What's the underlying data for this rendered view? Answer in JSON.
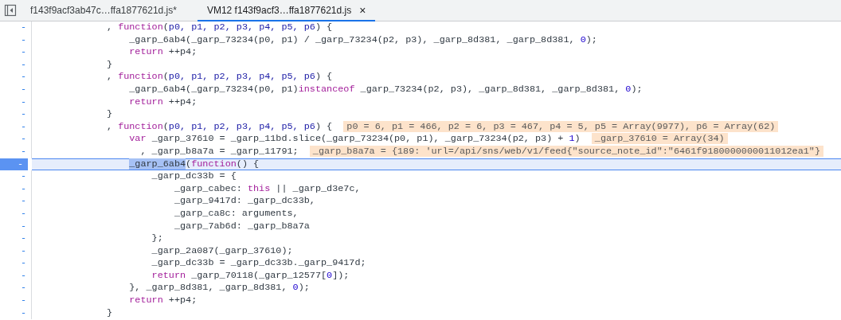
{
  "tabs": [
    {
      "label": "f143f9acf3ab47c…ffa1877621d.js*",
      "selected": false
    },
    {
      "label": "VM12 f143f9acf3…ffa1877621d.js",
      "selected": true,
      "close": "×"
    }
  ],
  "editor": {
    "lines": [
      {
        "gutter": "-",
        "current": false,
        "segments": [
          {
            "kind": "plain",
            "text": "            , "
          },
          {
            "kind": "keyword",
            "text": "function"
          },
          {
            "kind": "plain",
            "text": "("
          },
          {
            "kind": "param",
            "text": "p0, p1, p2, p3, p4, p5, p6"
          },
          {
            "kind": "plain",
            "text": ") {"
          }
        ]
      },
      {
        "gutter": "-",
        "current": false,
        "segments": [
          {
            "kind": "plain",
            "text": "                _garp_6ab4(_garp_73234(p0, p1) / _garp_73234(p2, p3), _garp_8d381, _garp_8d381, "
          },
          {
            "kind": "number",
            "text": "0"
          },
          {
            "kind": "plain",
            "text": ");"
          }
        ]
      },
      {
        "gutter": "-",
        "current": false,
        "segments": [
          {
            "kind": "keyword",
            "text": "                return"
          },
          {
            "kind": "plain",
            "text": " ++p4;"
          }
        ]
      },
      {
        "gutter": "-",
        "current": false,
        "segments": [
          {
            "kind": "plain",
            "text": "            }"
          }
        ]
      },
      {
        "gutter": "-",
        "current": false,
        "segments": [
          {
            "kind": "plain",
            "text": "            , "
          },
          {
            "kind": "keyword",
            "text": "function"
          },
          {
            "kind": "plain",
            "text": "("
          },
          {
            "kind": "param",
            "text": "p0, p1, p2, p3, p4, p5, p6"
          },
          {
            "kind": "plain",
            "text": ") {"
          }
        ]
      },
      {
        "gutter": "-",
        "current": false,
        "segments": [
          {
            "kind": "plain",
            "text": "                _garp_6ab4(_garp_73234(p0, p1)"
          },
          {
            "kind": "keyword",
            "text": "instanceof"
          },
          {
            "kind": "plain",
            "text": " _garp_73234(p2, p3), _garp_8d381, _garp_8d381, "
          },
          {
            "kind": "number",
            "text": "0"
          },
          {
            "kind": "plain",
            "text": ");"
          }
        ]
      },
      {
        "gutter": "-",
        "current": false,
        "segments": [
          {
            "kind": "keyword",
            "text": "                return"
          },
          {
            "kind": "plain",
            "text": " ++p4;"
          }
        ]
      },
      {
        "gutter": "-",
        "current": false,
        "segments": [
          {
            "kind": "plain",
            "text": "            }"
          }
        ]
      },
      {
        "gutter": "-",
        "current": false,
        "segments": [
          {
            "kind": "plain",
            "text": "            , "
          },
          {
            "kind": "keyword",
            "text": "function"
          },
          {
            "kind": "plain",
            "text": "("
          },
          {
            "kind": "param",
            "text": "p0, p1, p2, p3, p4, p5, p6"
          },
          {
            "kind": "plain",
            "text": ") {  "
          },
          {
            "kind": "inline_value",
            "text": "p0 = 6, p1 = 466, p2 = 6, p3 = 467, p4 = 5, p5 = Array(9977), p6 = Array(62)"
          }
        ]
      },
      {
        "gutter": "-",
        "current": false,
        "segments": [
          {
            "kind": "keyword",
            "text": "                var"
          },
          {
            "kind": "plain",
            "text": " _garp_37610 = _garp_11bd.slice(_garp_73234(p0, p1), _garp_73234(p2, p3) + "
          },
          {
            "kind": "number",
            "text": "1"
          },
          {
            "kind": "plain",
            "text": ")  "
          },
          {
            "kind": "inline_value",
            "text": "_garp_37610 = Array(34)"
          }
        ]
      },
      {
        "gutter": "-",
        "current": false,
        "segments": [
          {
            "kind": "plain",
            "text": "                  , _garp_b8a7a = _garp_11791;  "
          },
          {
            "kind": "inline_value",
            "text": "_garp_b8a7a = {189: 'url=/api/sns/web/v1/feed{\"source_note_id\":\"6461f9180000000011012ea1\"}"
          }
        ]
      },
      {
        "gutter": "-",
        "current": true,
        "segments": [
          {
            "kind": "selection",
            "text": "                _garp_6ab4"
          },
          {
            "kind": "plain",
            "text": "("
          },
          {
            "kind": "keyword",
            "text": "function"
          },
          {
            "kind": "plain",
            "text": "() {"
          }
        ]
      },
      {
        "gutter": "-",
        "current": false,
        "segments": [
          {
            "kind": "plain",
            "text": "                    _garp_dc33b = {"
          }
        ]
      },
      {
        "gutter": "-",
        "current": false,
        "segments": [
          {
            "kind": "plain",
            "text": "                        _garp_cabec: "
          },
          {
            "kind": "keyword",
            "text": "this"
          },
          {
            "kind": "plain",
            "text": " || _garp_d3e7c,"
          }
        ]
      },
      {
        "gutter": "-",
        "current": false,
        "segments": [
          {
            "kind": "plain",
            "text": "                        _garp_9417d: _garp_dc33b,"
          }
        ]
      },
      {
        "gutter": "-",
        "current": false,
        "segments": [
          {
            "kind": "plain",
            "text": "                        _garp_ca8c: arguments,"
          }
        ]
      },
      {
        "gutter": "-",
        "current": false,
        "segments": [
          {
            "kind": "plain",
            "text": "                        _garp_7ab6d: _garp_b8a7a"
          }
        ]
      },
      {
        "gutter": "-",
        "current": false,
        "segments": [
          {
            "kind": "plain",
            "text": "                    };"
          }
        ]
      },
      {
        "gutter": "-",
        "current": false,
        "segments": [
          {
            "kind": "plain",
            "text": "                    _garp_2a087(_garp_37610);"
          }
        ]
      },
      {
        "gutter": "-",
        "current": false,
        "segments": [
          {
            "kind": "plain",
            "text": "                    _garp_dc33b = _garp_dc33b._garp_9417d;"
          }
        ]
      },
      {
        "gutter": "-",
        "current": false,
        "segments": [
          {
            "kind": "keyword",
            "text": "                    return"
          },
          {
            "kind": "plain",
            "text": " _garp_70118(_garp_12577["
          },
          {
            "kind": "number",
            "text": "0"
          },
          {
            "kind": "plain",
            "text": "]);"
          }
        ]
      },
      {
        "gutter": "-",
        "current": false,
        "segments": [
          {
            "kind": "plain",
            "text": "                }, _garp_8d381, _garp_8d381, "
          },
          {
            "kind": "number",
            "text": "0"
          },
          {
            "kind": "plain",
            "text": ");"
          }
        ]
      },
      {
        "gutter": "-",
        "current": false,
        "segments": [
          {
            "kind": "keyword",
            "text": "                return"
          },
          {
            "kind": "plain",
            "text": " ++p4;"
          }
        ]
      },
      {
        "gutter": "-",
        "current": false,
        "segments": [
          {
            "kind": "plain",
            "text": "            }"
          }
        ]
      }
    ]
  }
}
